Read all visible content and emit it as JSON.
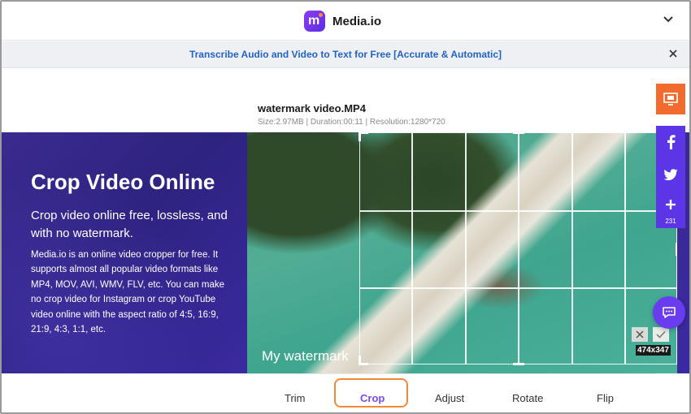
{
  "header": {
    "brand": "Media.io",
    "logo_letter": "m",
    "icons": {
      "logo": "media-io-logo-icon",
      "menu_toggle": "chevron-down-icon"
    }
  },
  "banner": {
    "link_text": "Transcribe Audio and Video to Text for Free [Accurate & Automatic]",
    "close_icon": "close-icon"
  },
  "hero": {
    "title": "Crop Video Online",
    "subtitle": "Crop video online free, lossless, and with no watermark.",
    "description": "Media.io is an online video cropper for free. It supports almost all popular video formats like MP4, MOV, AVI, WMV, FLV, etc. You can make no crop video for Instagram or crop YouTube video online with the aspect ratio of 4:5, 16:9, 21:9, 4:3, 1:1, etc."
  },
  "editor": {
    "file_name": "watermark video.MP4",
    "file_meta": "Size:2.97MB | Duration:00:11 | Resolution:1280*720",
    "watermark_text": "My watermark",
    "crop_size": "474x347",
    "tabs": [
      {
        "label": "Trim",
        "active": false
      },
      {
        "label": "Crop",
        "active": true
      },
      {
        "label": "Adjust",
        "active": false
      },
      {
        "label": "Rotate",
        "active": false
      },
      {
        "label": "Flip",
        "active": false
      }
    ]
  },
  "share": {
    "count": "231",
    "icons": [
      "screen-icon",
      "facebook-icon",
      "twitter-icon",
      "plus-icon",
      "chat-icon"
    ]
  },
  "colors": {
    "brand_purple": "#7a4af0",
    "hero_bg": "#2d2380",
    "link_blue": "#2263c7",
    "highlight_orange": "#f08a3a",
    "share_orange": "#f06b2d",
    "share_purple": "#5b35e6"
  }
}
